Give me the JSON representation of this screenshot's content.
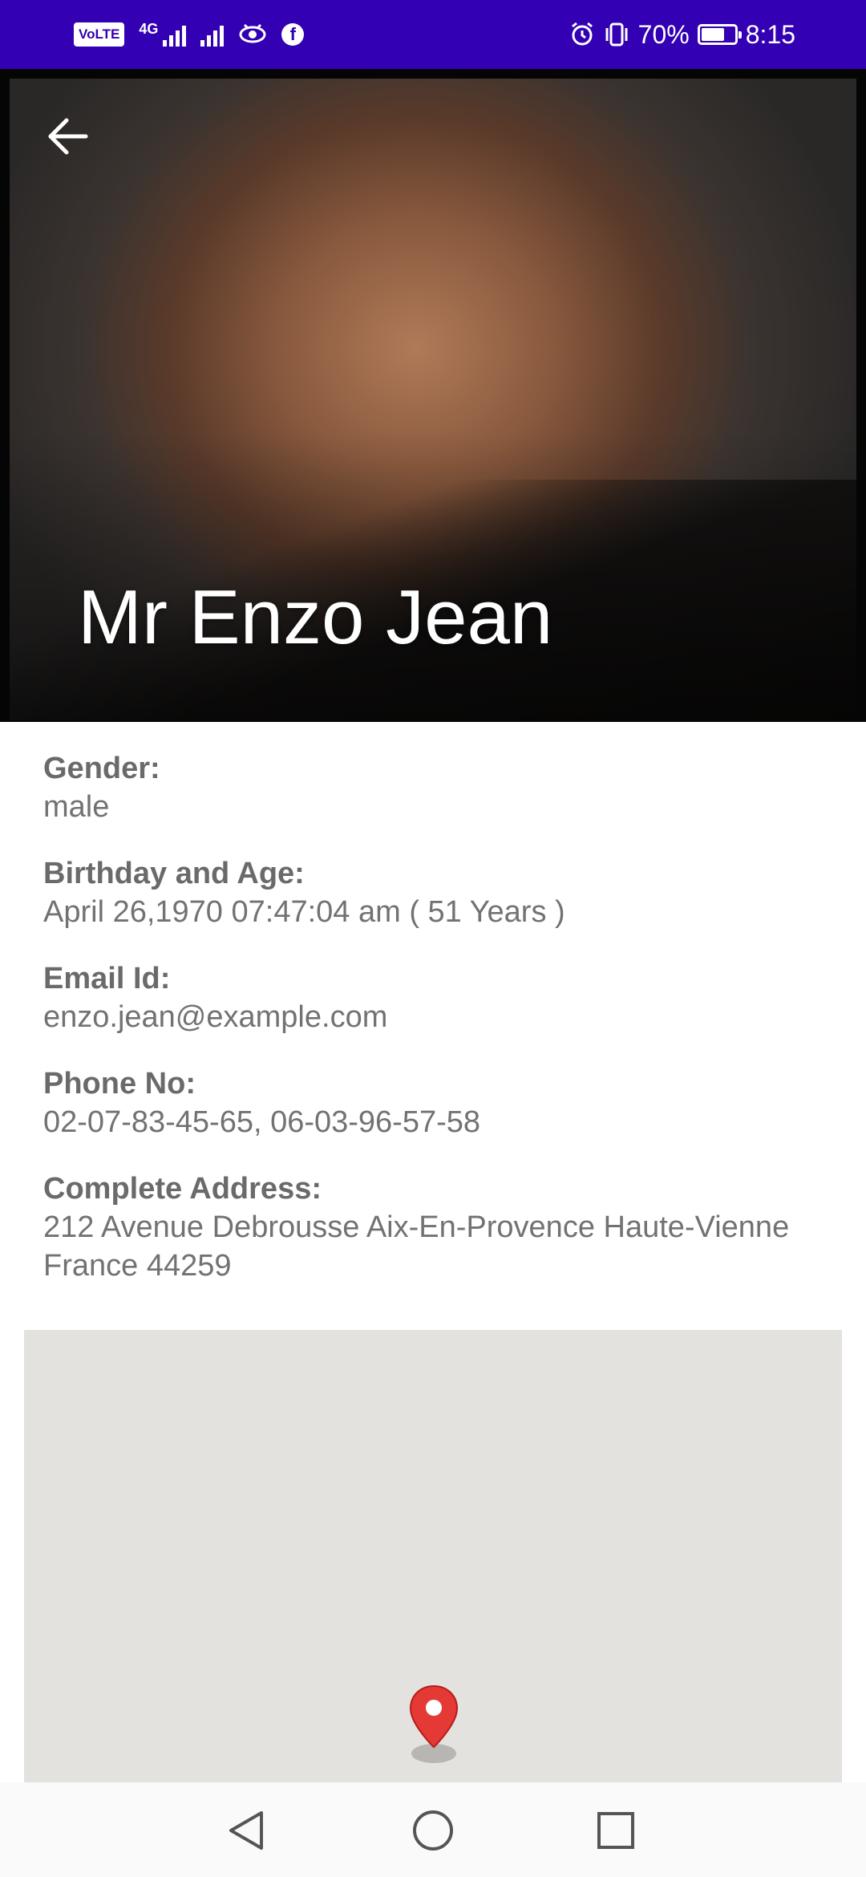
{
  "status_bar": {
    "battery_percent": "70%",
    "battery_level": 0.7,
    "time": "8:15",
    "network": "4G",
    "volte_label": "VoLTE",
    "icons": [
      "volte-icon",
      "signal-icon",
      "eye-icon",
      "facebook-icon",
      "alarm-icon",
      "vibrate-icon",
      "battery-icon"
    ]
  },
  "header": {
    "name": "Mr Enzo Jean",
    "back_icon": "arrow-left-icon"
  },
  "details": {
    "gender_label": "Gender:",
    "gender_value": "male",
    "birthday_label": "Birthday and Age:",
    "birthday_value": "April 26,1970 07:47:04 am ( 51 Years )",
    "email_label": "Email Id:",
    "email_value": "enzo.jean@example.com",
    "phone_label": "Phone No:",
    "phone_value": "02-07-83-45-65, 06-03-96-57-58",
    "address_label": "Complete Address:",
    "address_line1": "212 Avenue Debrousse Aix-En-Provence Haute-Vienne",
    "address_line2": "France 44259"
  },
  "map": {
    "marker_icon": "map-pin-icon",
    "marker_color": "#e53935"
  },
  "nav_bar": {
    "icons": [
      "back-triangle-icon",
      "home-circle-icon",
      "recents-square-icon"
    ]
  },
  "colors": {
    "status_bar": "#3300b3",
    "label_text": "#6a6a6a",
    "map_bg": "#e4e2de"
  }
}
